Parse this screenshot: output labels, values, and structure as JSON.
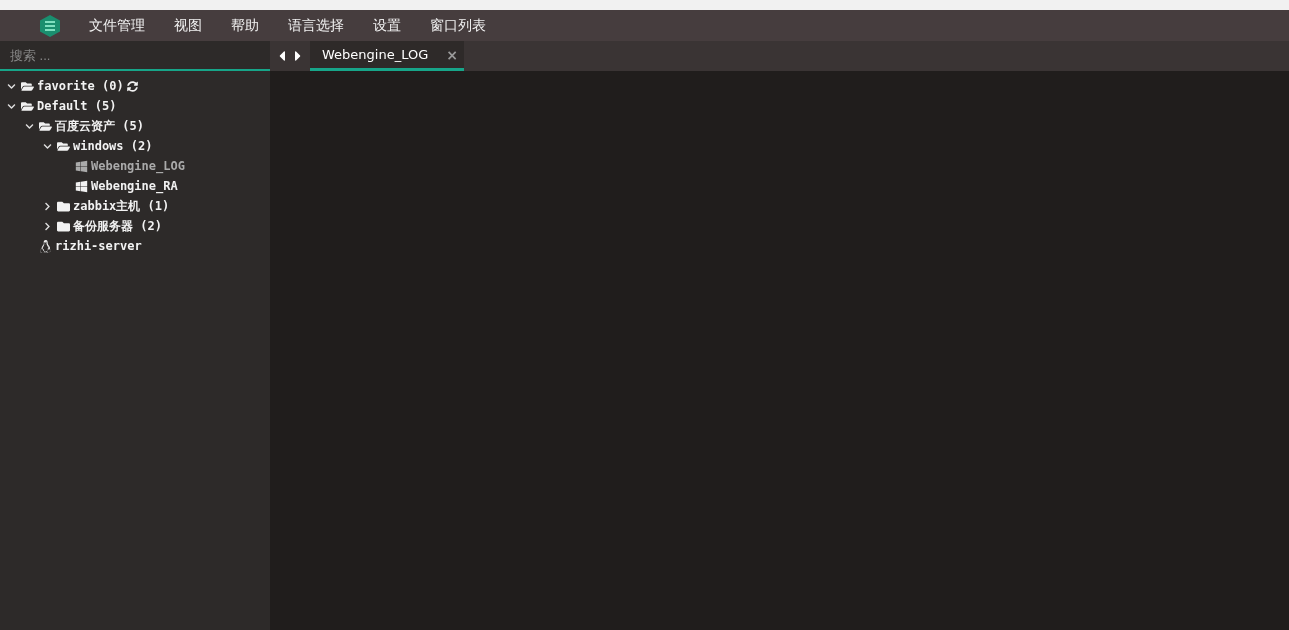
{
  "menu": [
    {
      "label": "文件管理"
    },
    {
      "label": "视图"
    },
    {
      "label": "帮助"
    },
    {
      "label": "语言选择"
    },
    {
      "label": "设置"
    },
    {
      "label": "窗口列表"
    }
  ],
  "search": {
    "placeholder": "搜索 ..."
  },
  "tree": [
    {
      "kind": "folder",
      "label": "favorite (0)",
      "expanded": true,
      "refresh": true
    },
    {
      "kind": "folder",
      "label": "Default (5)",
      "expanded": true,
      "children": [
        {
          "kind": "folder",
          "label": "百度云资产 (5)",
          "expanded": true,
          "children": [
            {
              "kind": "folder",
              "label": "windows (2)",
              "expanded": true,
              "children": [
                {
                  "kind": "windows",
                  "label": "Webengine_LOG",
                  "dimmed": true
                },
                {
                  "kind": "windows",
                  "label": "Webengine_RA",
                  "dimmed": false
                }
              ]
            },
            {
              "kind": "folder",
              "label": "zabbix主机 (1)",
              "expanded": false
            },
            {
              "kind": "folder",
              "label": "备份服务器 (2)",
              "expanded": false
            }
          ]
        },
        {
          "kind": "linux",
          "label": "rizhi-server",
          "dimmed": false
        }
      ]
    }
  ],
  "tabs": [
    {
      "label": "Webengine_LOG",
      "selected": true,
      "close": "×"
    }
  ]
}
